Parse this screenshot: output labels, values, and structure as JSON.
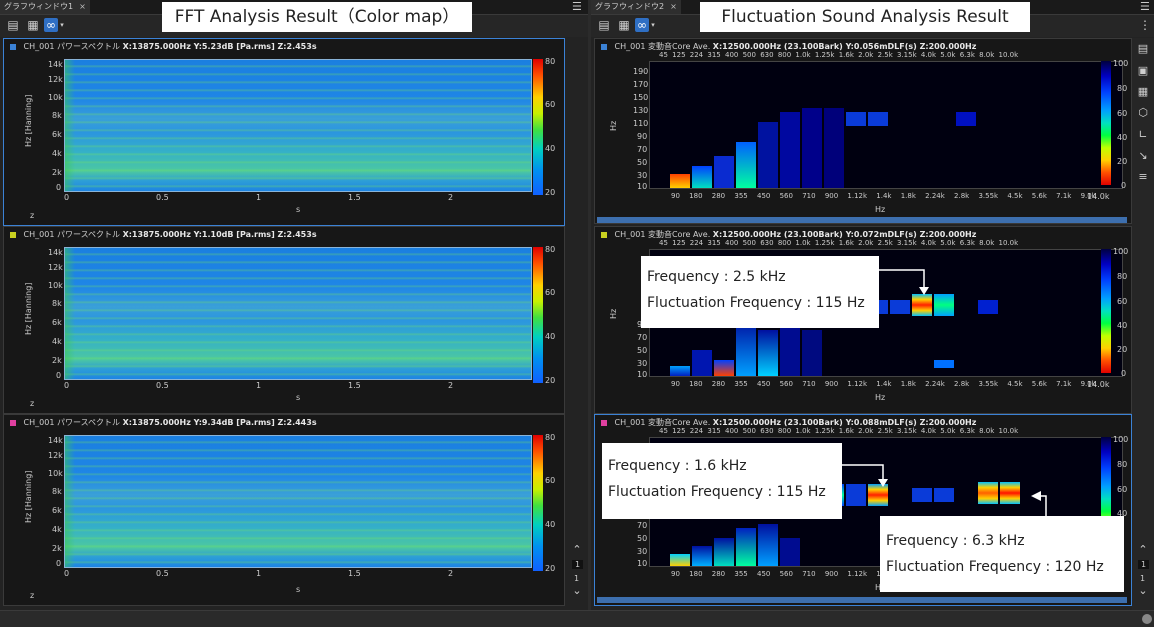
{
  "headings": {
    "left": "FFT Analysis Result（Color map）",
    "right": "Fluctuation Sound Analysis Result"
  },
  "left_window": {
    "tab": "グラフウィンドウ1",
    "tab_close": "×",
    "menu": "☰",
    "more": "⋮",
    "panels": [
      {
        "ch": "CH_001",
        "kind": "パワースペクトル",
        "readout": "X:13875.000Hz Y:5.23dB [Pa.rms]   Z:2.453s",
        "color": "#3b82d6"
      },
      {
        "ch": "CH_001",
        "kind": "パワースペクトル",
        "readout": "X:13875.000Hz Y:1.10dB [Pa.rms]   Z:2.453s",
        "color": "#c8d020"
      },
      {
        "ch": "CH_001",
        "kind": "パワースペクトル",
        "readout": "X:13875.000Hz Y:9.34dB [Pa.rms]   Z:2.443s",
        "color": "#e040a0"
      }
    ],
    "y_ticks": [
      "14k",
      "12k",
      "10k",
      "8k",
      "6k",
      "4k",
      "2k",
      "0"
    ],
    "x_ticks": [
      "0",
      "0.5",
      "1",
      "1.5",
      "2"
    ],
    "x_label": "s",
    "y_label": "Hz [Hanning]",
    "cbar_ticks": [
      "80",
      "60",
      "40",
      "20"
    ],
    "corner_z": "z",
    "page_nums": [
      "1",
      "1"
    ]
  },
  "right_window": {
    "tab": "グラフウィンドウ2",
    "tab_close": "×",
    "menu": "☰",
    "more": "⋮",
    "panels": [
      {
        "ch": "CH_001",
        "kind": "変動音Core",
        "ave": "Ave.",
        "readout": "X:12500.000Hz (23.100Bark) Y:0.056mDLF(s)  Z:200.000Hz",
        "color": "#3b82d6"
      },
      {
        "ch": "CH_001",
        "kind": "変動音Core",
        "ave": "Ave.",
        "readout": "X:12500.000Hz (23.100Bark) Y:0.072mDLF(s)  Z:200.000Hz",
        "color": "#c8d020"
      },
      {
        "ch": "CH_001",
        "kind": "変動音Core",
        "ave": "Ave.",
        "readout": "X:12500.000Hz (23.100Bark) Y:0.088mDLF(s) Z:200.000Hz",
        "color": "#e040a0"
      }
    ],
    "top_ticks": [
      "45",
      "125",
      "224",
      "315",
      "400",
      "500",
      "630",
      "800",
      "1.0k",
      "1.25k",
      "1.6k",
      "2.0k",
      "2.5k",
      "3.15k",
      "4.0k",
      "5.0k",
      "6.3k",
      "8.0k",
      "10.0k"
    ],
    "bottom_ticks": [
      "90",
      "180",
      "280",
      "355",
      "450",
      "560",
      "710",
      "900",
      "1.12k",
      "1.4k",
      "1.8k",
      "2.24k",
      "2.8k",
      "3.55k",
      "4.5k",
      "5.6k",
      "7.1k",
      "9.0k"
    ],
    "bottom_end": "14.0k",
    "y_ticks": [
      "190",
      "170",
      "150",
      "130",
      "110",
      "90",
      "70",
      "50",
      "30",
      "10"
    ],
    "y_label": "Hz",
    "x_label": "Hz",
    "cbar_ticks": [
      "100",
      "80",
      "60",
      "40",
      "20",
      "0"
    ],
    "page_nums": [
      "1",
      "1"
    ]
  },
  "callouts": {
    "a_freq": "Frequency : 2.5 kHz",
    "a_fluct": "Fluctuation Frequency : 115 Hz",
    "b_freq": "Frequency : 1.6 kHz",
    "b_fluct": "Fluctuation Frequency : 115 Hz",
    "c_freq": "Frequency : 6.3 kHz",
    "c_fluct": "Fluctuation Frequency : 120 Hz"
  },
  "colors": {
    "accent": "#3b82d6",
    "panel_bg": "#171717",
    "window_bg": "#232323"
  }
}
